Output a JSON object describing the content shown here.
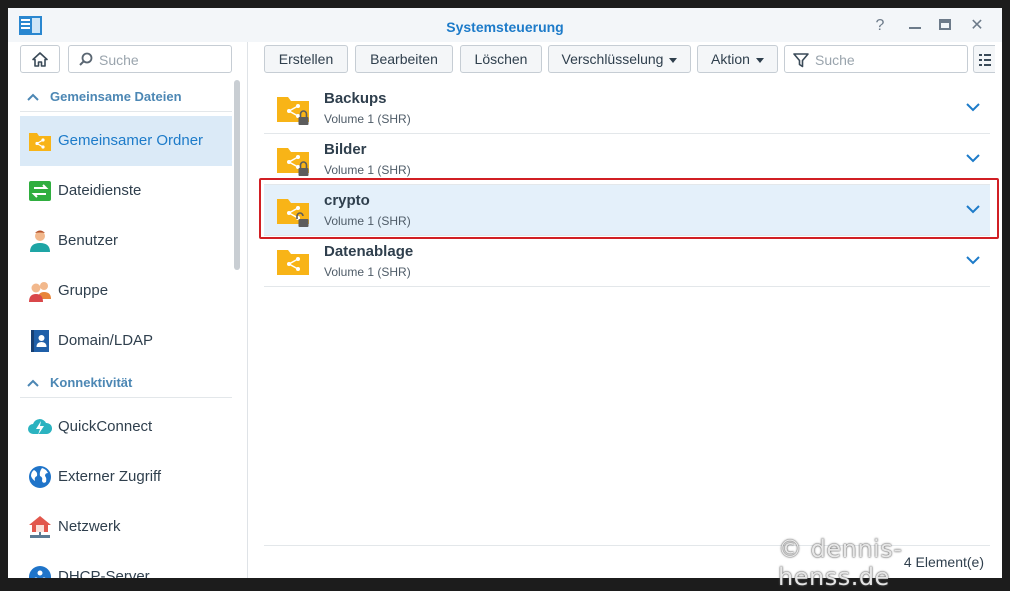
{
  "window": {
    "title": "Systemsteuerung",
    "help_glyph": "?",
    "maximize_glyph": "▭",
    "close_glyph": "✕"
  },
  "sidebar": {
    "search_placeholder": "Suche",
    "sections": [
      {
        "label": "Gemeinsame Dateien",
        "items": [
          {
            "label": "Gemeinsamer Ordner",
            "icon": "shared-folder-icon",
            "active": true
          },
          {
            "label": "Dateidienste",
            "icon": "file-services-icon",
            "active": false
          },
          {
            "label": "Benutzer",
            "icon": "user-icon",
            "active": false
          },
          {
            "label": "Gruppe",
            "icon": "group-icon",
            "active": false
          },
          {
            "label": "Domain/LDAP",
            "icon": "domain-ldap-icon",
            "active": false
          }
        ]
      },
      {
        "label": "Konnektivität",
        "items": [
          {
            "label": "QuickConnect",
            "icon": "quickconnect-icon",
            "active": false
          },
          {
            "label": "Externer Zugriff",
            "icon": "globe-icon",
            "active": false
          },
          {
            "label": "Netzwerk",
            "icon": "network-icon",
            "active": false
          },
          {
            "label": "DHCP-Server",
            "icon": "dhcp-server-icon",
            "active": false
          }
        ]
      }
    ]
  },
  "toolbar": {
    "create_label": "Erstellen",
    "edit_label": "Bearbeiten",
    "delete_label": "Löschen",
    "encryption_label": "Verschlüsselung",
    "action_label": "Aktion",
    "filter_placeholder": "Suche"
  },
  "folders": [
    {
      "name": "Backups",
      "volume": "Volume 1 (SHR)",
      "lock": "locked",
      "selected": false
    },
    {
      "name": "Bilder",
      "volume": "Volume 1 (SHR)",
      "lock": "locked",
      "selected": false
    },
    {
      "name": "crypto",
      "volume": "Volume 1 (SHR)",
      "lock": "unlocked",
      "selected": true
    },
    {
      "name": "Datenablage",
      "volume": "Volume 1 (SHR)",
      "lock": "none",
      "selected": false
    }
  ],
  "footer": {
    "count_label": "4 Element(e)"
  },
  "watermark": "© dennis-henss.de",
  "colors": {
    "accent": "#1d7bc9",
    "folder": "#f8b417",
    "highlight": "#d11f24",
    "section_header": "#4c87b4"
  }
}
